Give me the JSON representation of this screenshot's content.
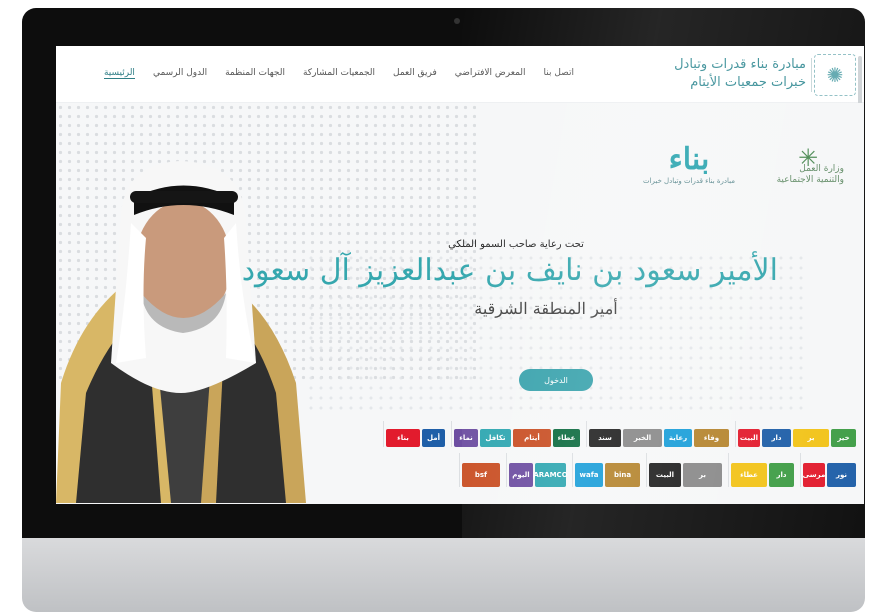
{
  "brand": {
    "line1": "مبادرة بناء قدرات وتبادل",
    "line2": "خبرات جمعيات الأيتام"
  },
  "nav": {
    "items": [
      {
        "label": "الرئيسية",
        "active": true
      },
      {
        "label": "الدول الرسمي"
      },
      {
        "label": "الجهات المنظمة"
      },
      {
        "label": "الجمعيات المشاركة"
      },
      {
        "label": "فريق العمل"
      },
      {
        "label": "المعرض الافتراضي"
      },
      {
        "label": "اتصل بنا"
      }
    ]
  },
  "ministry": {
    "line1": "وزارة العمل",
    "line2": "والتنمية الاجتماعية"
  },
  "bena": {
    "word": "بناء",
    "sub": "مبادرة بناء قدرات وتبادل خبرات"
  },
  "hero": {
    "patron_text": "تحت رعاية صاحب السمو الملكي",
    "prince_name": "الأمير سعود بن نايف بن عبدالعزيز آل سعود",
    "region_title": "أمير المنطقة الشرقية",
    "cta_label": "الدخول"
  },
  "sponsors": {
    "row1_marks": [
      "البيت",
      "دار",
      "بر",
      "خير",
      "سند",
      "الخبر",
      "رعاية",
      "وفاء",
      "نماء",
      "تكافل",
      "أيتام",
      "عطاء",
      "بناء",
      "أمل"
    ],
    "row2_marks": [
      "مرسى",
      "نور",
      "عطاء",
      "دار",
      "البيت",
      "بر",
      "wafa",
      "bina",
      "اليوم",
      "ARAMCO",
      "bsf"
    ]
  },
  "colors": {
    "accent": "#3aa3ad",
    "brand_teal": "#3a8f98",
    "ministry_green": "#4b8a53"
  }
}
